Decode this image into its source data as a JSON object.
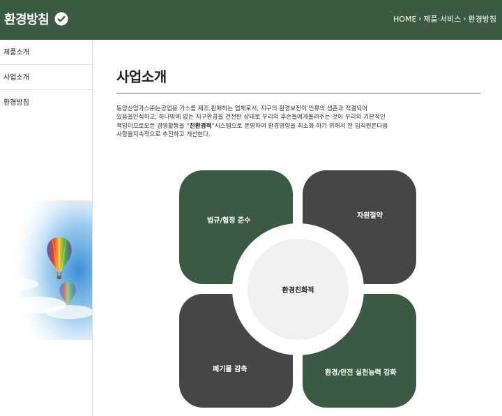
{
  "header": {
    "title": "환경방침",
    "breadcrumb": [
      "HOME",
      "제품·서비스",
      "환경방침"
    ]
  },
  "sidebar": {
    "items": [
      {
        "label": "제품소개"
      },
      {
        "label": "사업소개"
      },
      {
        "label": "환경방침"
      }
    ]
  },
  "main": {
    "title": "사업소개",
    "intro": {
      "line1": "동양산업가스㈜는공업용 가스를 제조,판매하는 업체로서, 지구의 환경보전이 인류의 생존과 직결되어",
      "line2": "있음을인식하고, 하나밖에 없는 지구환경을 건전한 상태로 우리의 후손들에게물려주는 것이 우리의 기본적인",
      "line3_pre": "책임이므로모든 경영활동을 “",
      "line3_bold": "친환경적",
      "line3_post": "”시스템으로 운영하여 환경영향을 최소화 하기 위해서 전 임직원은다음",
      "line4": "사항을지속적으로 추진하고 개선한다."
    },
    "diagram": {
      "center": "환경친화적",
      "petals": [
        "법규/협정 준수",
        "자원절약",
        "폐기물 감축",
        "환경/안전 실천능력 강화"
      ]
    }
  },
  "colors": {
    "brand_green": "#3c5a42",
    "dark_gray": "#464646",
    "center_gray": "#f0f0f0"
  }
}
